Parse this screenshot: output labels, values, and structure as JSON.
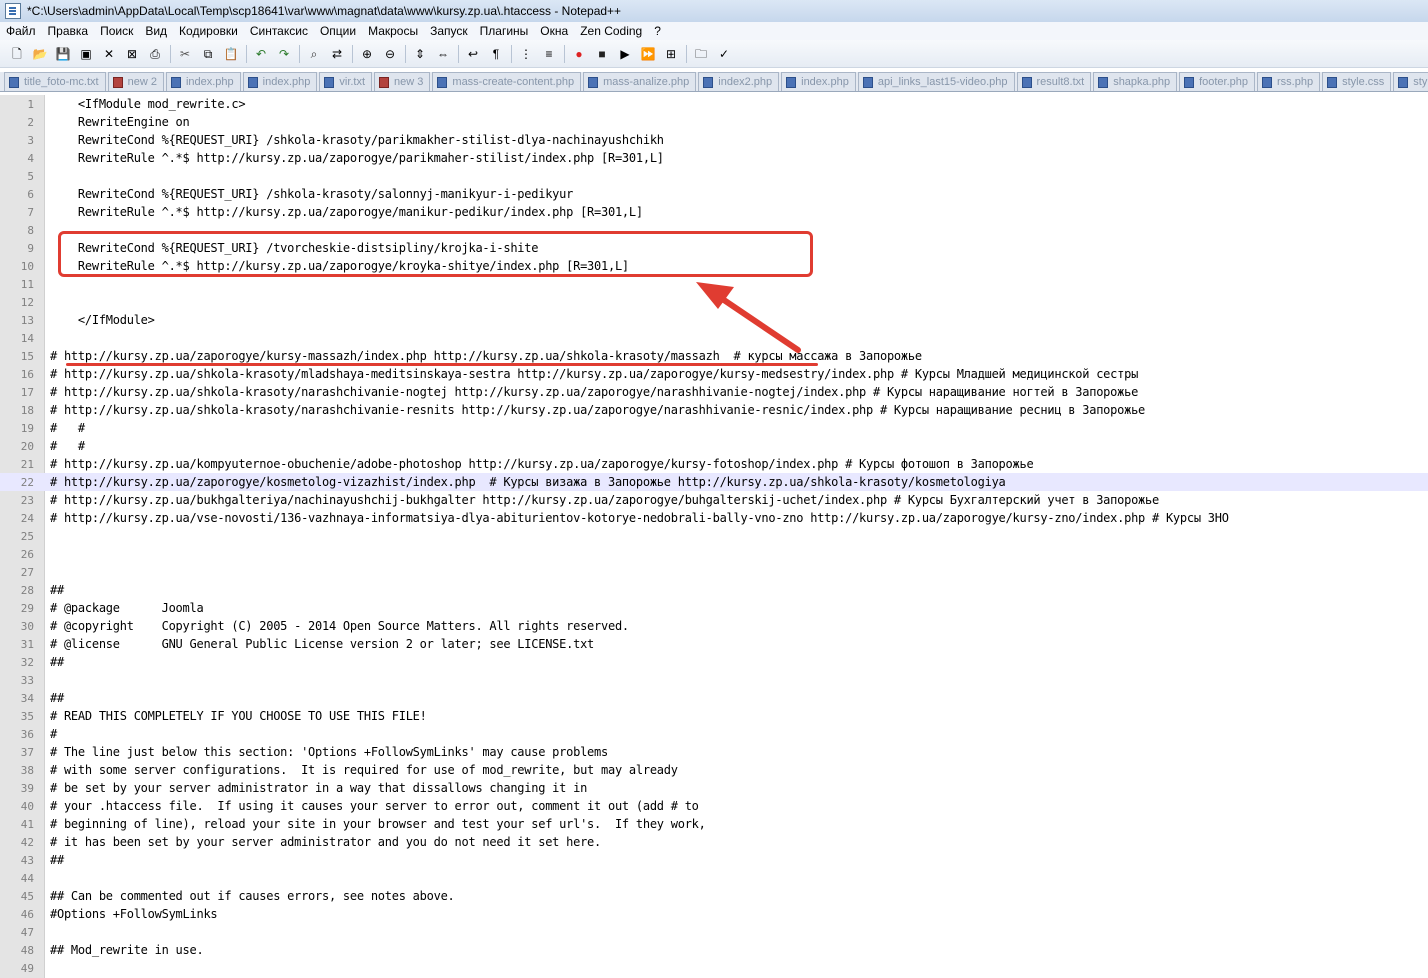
{
  "window": {
    "title": "*C:\\Users\\admin\\AppData\\Local\\Temp\\scp18641\\var\\www\\magnat\\data\\www\\kursy.zp.ua\\.htaccess - Notepad++"
  },
  "menu": [
    "Файл",
    "Правка",
    "Поиск",
    "Вид",
    "Кодировки",
    "Синтаксис",
    "Опции",
    "Макросы",
    "Запуск",
    "Плагины",
    "Окна",
    "Zen Coding",
    "?"
  ],
  "toolbar_groups": [
    [
      "new-file-icon",
      "open-file-icon",
      "save-icon",
      "save-all-icon",
      "close-icon",
      "close-all-icon",
      "print-icon"
    ],
    [
      "cut-icon",
      "copy-icon",
      "paste-icon"
    ],
    [
      "undo-icon",
      "redo-icon"
    ],
    [
      "find-icon",
      "replace-icon"
    ],
    [
      "zoom-in-icon",
      "zoom-out-icon"
    ],
    [
      "sync-vertical-icon",
      "sync-horizontal-icon"
    ],
    [
      "word-wrap-icon",
      "show-all-chars-icon"
    ],
    [
      "indent-guide-icon",
      "function-list-icon"
    ],
    [
      "record-macro-icon",
      "stop-record-icon",
      "play-macro-icon",
      "play-multiple-icon",
      "save-macro-icon"
    ],
    [
      "folder-icon",
      "spellcheck-icon"
    ]
  ],
  "tabs": [
    {
      "label": "title_foto-mc.txt",
      "unsaved": false
    },
    {
      "label": "new 2",
      "unsaved": true
    },
    {
      "label": "index.php",
      "unsaved": false
    },
    {
      "label": "index.php",
      "unsaved": false
    },
    {
      "label": "vir.txt",
      "unsaved": false
    },
    {
      "label": "new 3",
      "unsaved": true
    },
    {
      "label": "mass-create-content.php",
      "unsaved": false
    },
    {
      "label": "mass-analize.php",
      "unsaved": false
    },
    {
      "label": "index2.php",
      "unsaved": false
    },
    {
      "label": "index.php",
      "unsaved": false
    },
    {
      "label": "api_links_last15-video.php",
      "unsaved": false
    },
    {
      "label": "result8.txt",
      "unsaved": false
    },
    {
      "label": "shapka.php",
      "unsaved": false
    },
    {
      "label": "footer.php",
      "unsaved": false
    },
    {
      "label": "rss.php",
      "unsaved": false
    },
    {
      "label": "style.css",
      "unsaved": false
    },
    {
      "label": "sty",
      "unsaved": false
    }
  ],
  "editor": {
    "current_line": 22,
    "lines": [
      {
        "num": "1",
        "text": "    <IfModule mod_rewrite.c>"
      },
      {
        "num": "2",
        "text": "    RewriteEngine on"
      },
      {
        "num": "3",
        "text": "    RewriteCond %{REQUEST_URI} /shkola-krasoty/parikmakher-stilist-dlya-nachinayushchikh"
      },
      {
        "num": "4",
        "text": "    RewriteRule ^.*$ http://kursy.zp.ua/zaporogye/parikmaher-stilist/index.php [R=301,L]"
      },
      {
        "num": "5",
        "text": ""
      },
      {
        "num": "6",
        "text": "    RewriteCond %{REQUEST_URI} /shkola-krasoty/salonnyj-manikyur-i-pedikyur"
      },
      {
        "num": "7",
        "text": "    RewriteRule ^.*$ http://kursy.zp.ua/zaporogye/manikur-pedikur/index.php [R=301,L]"
      },
      {
        "num": "8",
        "text": ""
      },
      {
        "num": "9",
        "text": "    RewriteCond %{REQUEST_URI} /tvorcheskie-distsipliny/krojka-i-shite"
      },
      {
        "num": "10",
        "text": "    RewriteRule ^.*$ http://kursy.zp.ua/zaporogye/kroyka-shitye/index.php [R=301,L]"
      },
      {
        "num": "11",
        "text": ""
      },
      {
        "num": "12",
        "text": ""
      },
      {
        "num": "13",
        "text": "    </IfModule>"
      },
      {
        "num": "14",
        "text": ""
      },
      {
        "num": "15",
        "text": "# http://kursy.zp.ua/zaporogye/kursy-massazh/index.php http://kursy.zp.ua/shkola-krasoty/massazh  # курсы массажа в Запорожье"
      },
      {
        "num": "16",
        "text": "# http://kursy.zp.ua/shkola-krasoty/mladshaya-meditsinskaya-sestra http://kursy.zp.ua/zaporogye/kursy-medsestry/index.php # Курсы Младшей медицинской сестры"
      },
      {
        "num": "17",
        "text": "# http://kursy.zp.ua/shkola-krasoty/narashchivanie-nogtej http://kursy.zp.ua/zaporogye/narashhivanie-nogtej/index.php # Курсы наращивание ногтей в Запорожье"
      },
      {
        "num": "18",
        "text": "# http://kursy.zp.ua/shkola-krasoty/narashchivanie-resnits http://kursy.zp.ua/zaporogye/narashhivanie-resnic/index.php # Курсы наращивание ресниц в Запорожье"
      },
      {
        "num": "19",
        "text": "#   #"
      },
      {
        "num": "20",
        "text": "#   #"
      },
      {
        "num": "21",
        "text": "# http://kursy.zp.ua/kompyuternoe-obuchenie/adobe-photoshop http://kursy.zp.ua/zaporogye/kursy-fotoshop/index.php # Курсы фотошоп в Запорожье"
      },
      {
        "num": "22",
        "text": "# http://kursy.zp.ua/zaporogye/kosmetolog-vizazhist/index.php  # Курсы визажа в Запорожье http://kursy.zp.ua/shkola-krasoty/kosmetologiya"
      },
      {
        "num": "23",
        "text": "# http://kursy.zp.ua/bukhgalteriya/nachinayushchij-bukhgalter http://kursy.zp.ua/zaporogye/buhgalterskij-uchet/index.php # Курсы Бухгалтерский учет в Запорожье"
      },
      {
        "num": "24",
        "text": "# http://kursy.zp.ua/vse-novosti/136-vazhnaya-informatsiya-dlya-abiturientov-kotorye-nedobrali-bally-vno-zno http://kursy.zp.ua/zaporogye/kursy-zno/index.php # Курсы ЗНО"
      },
      {
        "num": "25",
        "text": ""
      },
      {
        "num": "26",
        "text": ""
      },
      {
        "num": "27",
        "text": ""
      },
      {
        "num": "28",
        "text": "##"
      },
      {
        "num": "29",
        "text": "# @package      Joomla"
      },
      {
        "num": "30",
        "text": "# @copyright    Copyright (C) 2005 - 2014 Open Source Matters. All rights reserved."
      },
      {
        "num": "31",
        "text": "# @license      GNU General Public License version 2 or later; see LICENSE.txt"
      },
      {
        "num": "32",
        "text": "##"
      },
      {
        "num": "33",
        "text": ""
      },
      {
        "num": "34",
        "text": "##"
      },
      {
        "num": "35",
        "text": "# READ THIS COMPLETELY IF YOU CHOOSE TO USE THIS FILE!"
      },
      {
        "num": "36",
        "text": "#"
      },
      {
        "num": "37",
        "text": "# The line just below this section: 'Options +FollowSymLinks' may cause problems"
      },
      {
        "num": "38",
        "text": "# with some server configurations.  It is required for use of mod_rewrite, but may already"
      },
      {
        "num": "39",
        "text": "# be set by your server administrator in a way that dissallows changing it in"
      },
      {
        "num": "40",
        "text": "# your .htaccess file.  If using it causes your server to error out, comment it out (add # to"
      },
      {
        "num": "41",
        "text": "# beginning of line), reload your site in your browser and test your sef url's.  If they work,"
      },
      {
        "num": "42",
        "text": "# it has been set by your server administrator and you do not need it set here."
      },
      {
        "num": "43",
        "text": "##"
      },
      {
        "num": "44",
        "text": ""
      },
      {
        "num": "45",
        "text": "## Can be commented out if causes errors, see notes above."
      },
      {
        "num": "46",
        "text": "#Options +FollowSymLinks"
      },
      {
        "num": "47",
        "text": ""
      },
      {
        "num": "48",
        "text": "## Mod_rewrite in use."
      },
      {
        "num": "49",
        "text": ""
      }
    ]
  },
  "annotation_colors": {
    "markup": "#e03c31",
    "current_line": "#e8e8ff"
  }
}
